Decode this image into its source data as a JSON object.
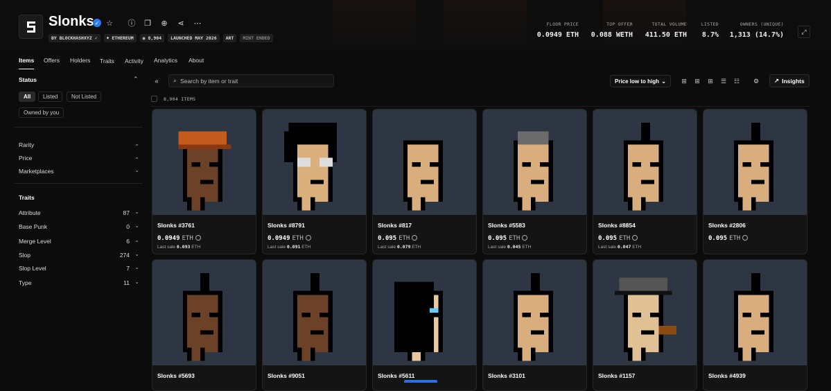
{
  "collection": {
    "title": "Slonks",
    "chips": [
      "BY BLOCKHASHXYZ",
      "ETHEREUM",
      "8,904",
      "LAUNCHED MAY 2026",
      "ART",
      "MINT ENDED"
    ]
  },
  "stats": [
    {
      "label": "FLOOR PRICE",
      "value": "0.0949 ETH"
    },
    {
      "label": "TOP OFFER",
      "value": "0.088 WETH"
    },
    {
      "label": "TOTAL VOLUME",
      "value": "411.50 ETH"
    },
    {
      "label": "LISTED",
      "value": "8.7%"
    },
    {
      "label": "OWNERS (UNIQUE)",
      "value": "1,313 (14.7%)"
    }
  ],
  "tabs": [
    "Items",
    "Offers",
    "Holders",
    "Traits",
    "Activity",
    "Analytics",
    "About"
  ],
  "sidebar": {
    "status_title": "Status",
    "status_pills": [
      "All",
      "Listed",
      "Not Listed",
      "Owned by you"
    ],
    "filters": [
      "Rarity",
      "Price",
      "Marketplaces"
    ],
    "traits_title": "Traits",
    "traits": [
      {
        "name": "Attribute",
        "count": "87"
      },
      {
        "name": "Base Punk",
        "count": "0"
      },
      {
        "name": "Merge Level",
        "count": "6"
      },
      {
        "name": "Slop",
        "count": "274"
      },
      {
        "name": "Slop Level",
        "count": "7"
      },
      {
        "name": "Type",
        "count": "11"
      }
    ]
  },
  "toolbar": {
    "search_placeholder": "Search by item or trait",
    "sort_label": "Price low to high",
    "insights_label": "Insights",
    "items_count": "8,904 ITEMS"
  },
  "cards": [
    {
      "name": "Slonks #3761",
      "price": "0.0949",
      "currency": "ETH",
      "last_label": "Last sale",
      "last": "0.093",
      "last_cur": "ETH",
      "skin": "#6b4227",
      "hair": "#c55a1e",
      "style": "cap"
    },
    {
      "name": "Slonks #8791",
      "price": "0.0949",
      "currency": "ETH",
      "last_label": "Last sale",
      "last": "0.091",
      "last_cur": "ETH",
      "skin": "#d9b07c",
      "hair": "#000000",
      "style": "shag"
    },
    {
      "name": "Slonks #817",
      "price": "0.095",
      "currency": "ETH",
      "last_label": "Last sale",
      "last": "0.079",
      "last_cur": "ETH",
      "skin": "#d9ae7e",
      "hair": "#2e3643",
      "style": "bald"
    },
    {
      "name": "Slonks #5583",
      "price": "0.095",
      "currency": "ETH",
      "last_label": "Last sale",
      "last": "0.045",
      "last_cur": "ETH",
      "skin": "#d9ae7e",
      "hair": "#6b6b6b",
      "style": "grey"
    },
    {
      "name": "Slonks #8854",
      "price": "0.095",
      "currency": "ETH",
      "last_label": "Last sale",
      "last": "0.047",
      "last_cur": "ETH",
      "skin": "#d9ae7e",
      "hair": "#000000",
      "style": "mohawk"
    },
    {
      "name": "Slonks #2806",
      "price": "0.095",
      "currency": "ETH",
      "last_label": "",
      "last": "",
      "last_cur": "",
      "skin": "#d9ae7e",
      "hair": "#000000",
      "style": "mohawk"
    },
    {
      "name": "Slonks #5693",
      "skin": "#6b4227",
      "hair": "#000000",
      "style": "mohawk"
    },
    {
      "name": "Slonks #9051",
      "skin": "#6b4227",
      "hair": "#000000",
      "style": "mohawk"
    },
    {
      "name": "Slonks #5611",
      "skin": "#e8c8a0",
      "hair": "#000000",
      "style": "long"
    },
    {
      "name": "Slonks #3101",
      "skin": "#d9ae7e",
      "hair": "#000000",
      "style": "mohawk"
    },
    {
      "name": "Slonks #1157",
      "skin": "#e0c095",
      "hair": "#555555",
      "style": "hat"
    },
    {
      "name": "Slonks #4939",
      "skin": "#d9ae7e",
      "hair": "#000000",
      "style": "mohawk"
    }
  ],
  "colors": {
    "accent": "#2a7bf2",
    "card_bg": "#2e3643",
    "page_bg": "#0c0c0c"
  }
}
